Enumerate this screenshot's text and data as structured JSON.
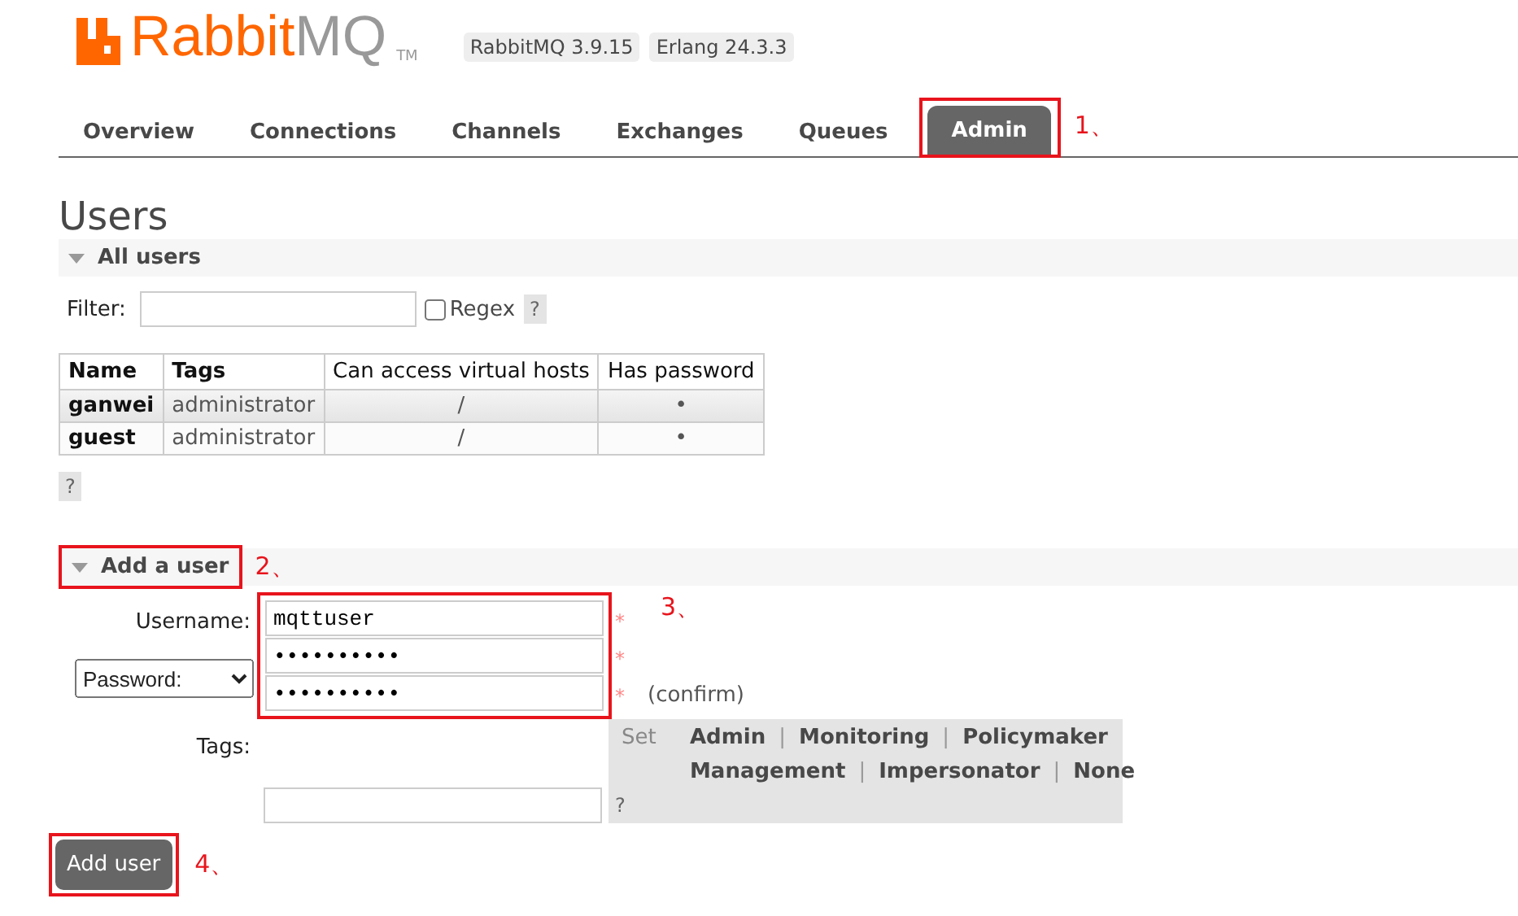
{
  "header": {
    "logo_primary": "Rabbit",
    "logo_secondary": "MQ",
    "logo_mark": "TM",
    "versions": [
      "RabbitMQ 3.9.15",
      "Erlang 24.3.3"
    ]
  },
  "tabs": [
    {
      "label": "Overview",
      "selected": false
    },
    {
      "label": "Connections",
      "selected": false
    },
    {
      "label": "Channels",
      "selected": false
    },
    {
      "label": "Exchanges",
      "selected": false
    },
    {
      "label": "Queues",
      "selected": false
    },
    {
      "label": "Admin",
      "selected": true,
      "callout": "1、"
    }
  ],
  "page_title": "Users",
  "all_users": {
    "title": "All users",
    "expanded": true,
    "filter_label": "Filter:",
    "regex_label": "Regex",
    "regex_checked": false,
    "help": "?",
    "table": {
      "columns": [
        "Name",
        "Tags",
        "Can access virtual hosts",
        "Has password"
      ],
      "rows": [
        [
          "ganwei",
          "administrator",
          "/",
          "•"
        ],
        [
          "guest",
          "administrator",
          "/",
          "•"
        ]
      ]
    },
    "table_help": "?"
  },
  "add_user": {
    "title": "Add a user",
    "expanded": true,
    "callout": "2、",
    "username_label": "Username:",
    "username": "mqttuser",
    "password_mode": "Password:",
    "password": "••••••••••",
    "confirm": "••••••••••",
    "required": "*",
    "confirm_note": "(confirm)",
    "fields_callout": "3、",
    "tags_label": "Tags:",
    "set_label": "Set",
    "tag_lines": [
      [
        "Admin",
        "Monitoring",
        "Policymaker"
      ],
      [
        "Management",
        "Impersonator",
        "None"
      ]
    ],
    "separator": "|",
    "tags_help": "?",
    "submit": "Add user",
    "submit_callout": "4、"
  }
}
